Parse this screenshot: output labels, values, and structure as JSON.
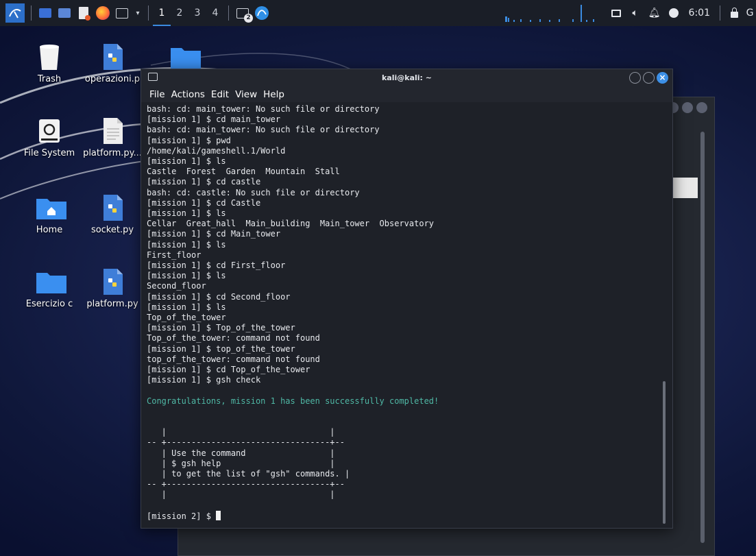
{
  "taskbar": {
    "workspaces": [
      "1",
      "2",
      "3",
      "4"
    ],
    "active_workspace": "1",
    "badge_count": "2",
    "clock": "6:01",
    "accent": "#3b8be0"
  },
  "desktop": {
    "icons": [
      {
        "label": "Trash",
        "icon": "trash-icon"
      },
      {
        "label": "operazioni.p",
        "icon": "python-file-icon"
      },
      {
        "label": "File System",
        "icon": "drive-icon"
      },
      {
        "label": "platform.py...",
        "icon": "text-file-icon"
      },
      {
        "label": "Home",
        "icon": "home-folder-icon"
      },
      {
        "label": "socket.py",
        "icon": "python-file-icon"
      },
      {
        "label": "Esercizio c",
        "icon": "folder-icon"
      },
      {
        "label": "platform.py",
        "icon": "python-file-icon"
      }
    ]
  },
  "terminal": {
    "title": "kali@kali: ~",
    "menu": [
      "File",
      "Actions",
      "Edit",
      "View",
      "Help"
    ],
    "lines": [
      "bash: cd: main_tower: No such file or directory",
      "[mission 1] $ cd main_tower",
      "bash: cd: main_tower: No such file or directory",
      "[mission 1] $ pwd",
      "/home/kali/gameshell.1/World",
      "[mission 1] $ ls",
      "Castle  Forest  Garden  Mountain  Stall",
      "[mission 1] $ cd castle",
      "bash: cd: castle: No such file or directory",
      "[mission 1] $ cd Castle",
      "[mission 1] $ ls",
      "Cellar  Great_hall  Main_building  Main_tower  Observatory",
      "[mission 1] $ cd Main_tower",
      "[mission 1] $ ls",
      "First_floor",
      "[mission 1] $ cd First_floor",
      "[mission 1] $ ls",
      "Second_floor",
      "[mission 1] $ cd Second_floor",
      "[mission 1] $ ls",
      "Top_of_the_tower",
      "[mission 1] $ Top_of_the_tower",
      "Top_of_the_tower: command not found",
      "[mission 1] $ top_of_the_tower",
      "top_of_the_tower: command not found",
      "[mission 1] $ cd Top_of_the_tower",
      "[mission 1] $ gsh check",
      ""
    ],
    "success_message": "Congratulations, mission 1 has been successfully completed!",
    "box_lines": [
      "",
      "",
      "   |                                 |",
      "-- +---------------------------------+--",
      "   | Use the command                 |",
      "   | $ gsh help                      |",
      "   | to get the list of \"gsh\" commands. |",
      "-- +---------------------------------+--",
      "   |                                 |",
      ""
    ],
    "prompt": "[mission 2] $ ",
    "success_color": "#4fb8a5"
  }
}
